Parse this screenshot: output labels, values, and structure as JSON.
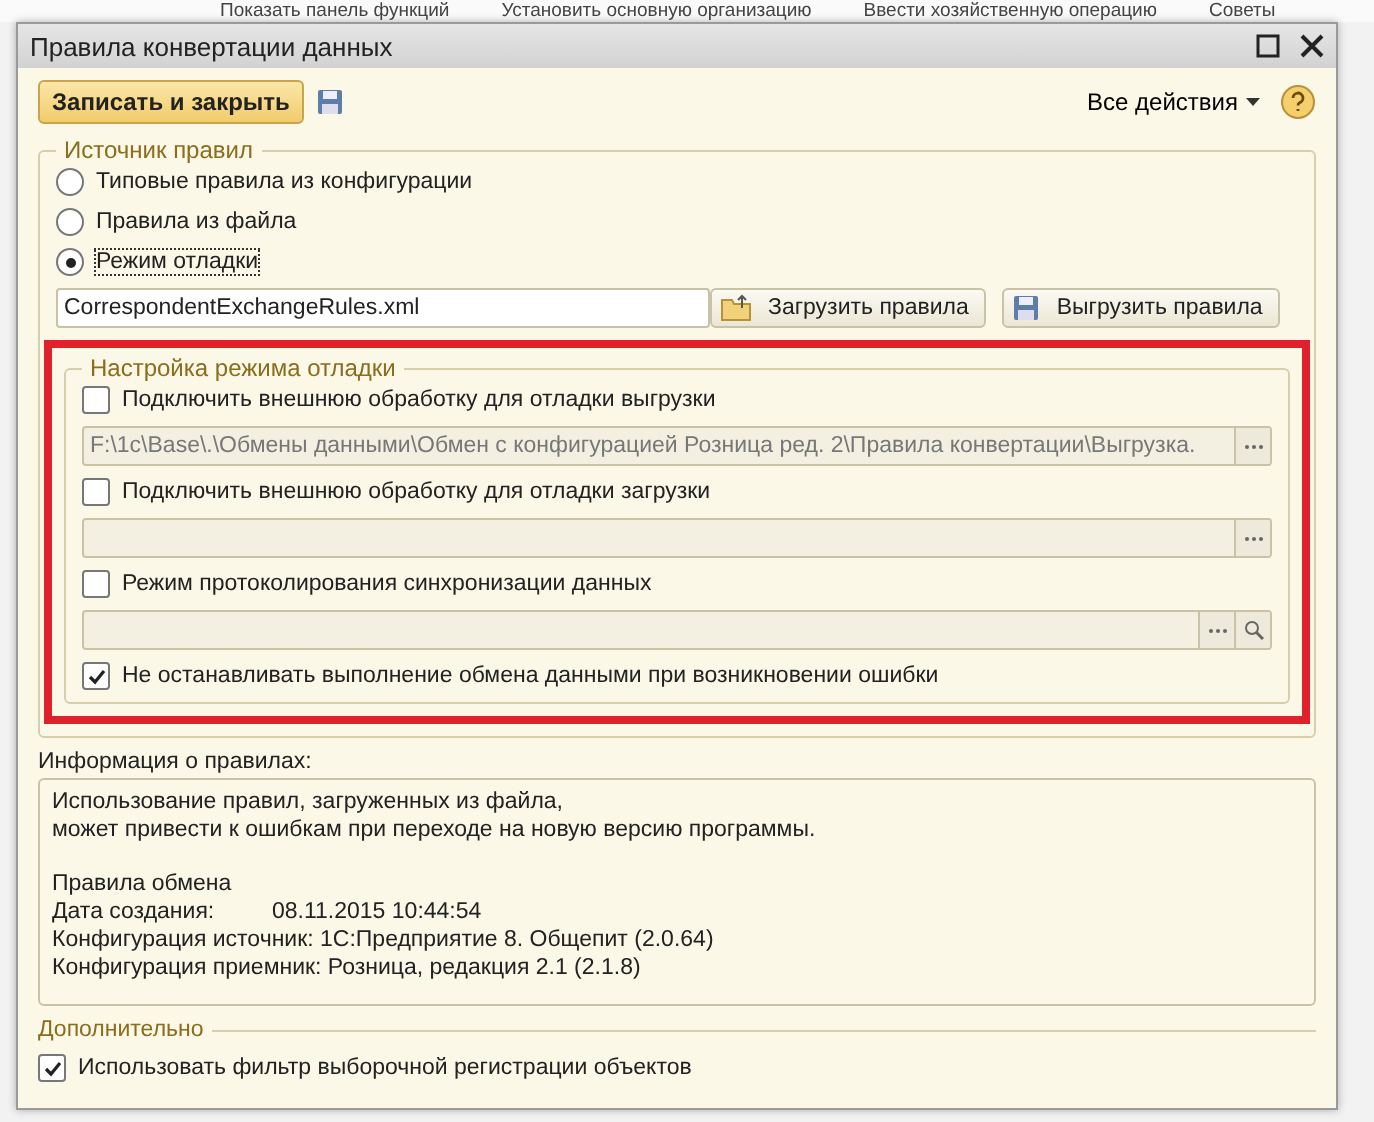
{
  "background_toolbar": [
    "Показать панель функций",
    "Установить основную организацию",
    "Ввести хозяйственную операцию",
    "Советы"
  ],
  "window": {
    "title": "Правила конвертации данных"
  },
  "toolbar": {
    "save_close": "Записать и закрыть",
    "all_actions": "Все действия"
  },
  "rules_source": {
    "title": "Источник правил",
    "options": [
      {
        "label": "Типовые правила из конфигурации",
        "selected": false
      },
      {
        "label": "Правила из файла",
        "selected": false
      },
      {
        "label": "Режим отладки",
        "selected": true
      }
    ],
    "file": "CorrespondentExchangeRules.xml",
    "buttons": [
      "Загрузить правила",
      "Выгрузить правила"
    ]
  },
  "debug": {
    "title": "Настройка режима отладки",
    "items": [
      {
        "kind": "checkbox",
        "label": "Подключить внешнюю обработку для отладки выгрузки",
        "checked": false
      },
      {
        "kind": "field",
        "value": "F:\\1c\\Base\\.\\Обмены данными\\Обмен с конфигурацией Розница ред. 2\\Правила конвертации\\Выгрузка.",
        "search_button": false
      },
      {
        "kind": "checkbox",
        "label": "Подключить внешнюю обработку для отладки загрузки",
        "checked": false
      },
      {
        "kind": "field",
        "search_button": false
      },
      {
        "kind": "checkbox",
        "label": "Режим протоколирования синхронизации данных",
        "checked": false
      },
      {
        "kind": "field",
        "search_button": true
      },
      {
        "kind": "checkbox",
        "label": "Не останавливать выполнение обмена данными при возникновении ошибки",
        "checked": true
      }
    ]
  },
  "info": {
    "title": "Информация о правилах:",
    "paragraphs": [
      [
        "Использование правил, загруженных из файла,",
        "может привести к ошибкам при переходе на новую версию программы."
      ],
      [
        "Правила обмена",
        [
          "Дата создания:",
          "08.11.2015 10:44:54"
        ],
        "Конфигурация источник: 1С:Предприятие 8. Общепит (2.0.64)",
        "Конфигурация приемник: Розница, редакция 2.1 (2.1.8)"
      ]
    ]
  },
  "additional": {
    "title": "Дополнительно",
    "checkboxes": [
      {
        "label": "Использовать фильтр выборочной регистрации объектов",
        "checked": true
      }
    ]
  }
}
